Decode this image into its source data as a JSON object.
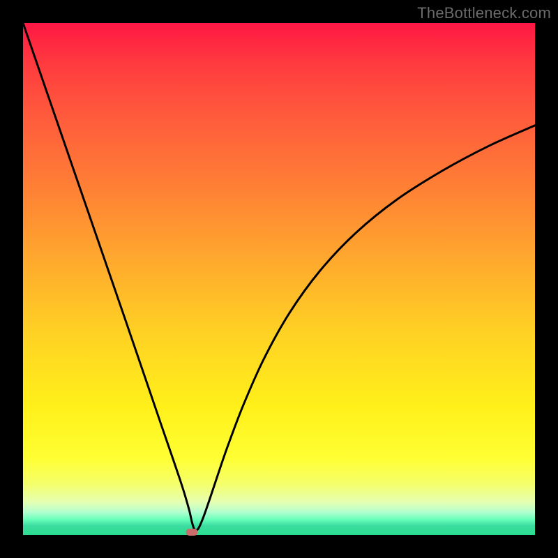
{
  "watermark": "TheBottleneck.com",
  "colors": {
    "curve": "#000000",
    "marker": "#cc6b6b",
    "frame": "#000000"
  },
  "chart_data": {
    "type": "line",
    "title": "",
    "xlabel": "",
    "ylabel": "",
    "xlim": [
      0,
      100
    ],
    "ylim": [
      0,
      100
    ],
    "grid": false,
    "legend": null,
    "series": [
      {
        "name": "bottleneck-curve",
        "x": [
          0,
          5,
          10,
          15,
          20,
          24,
          27,
          29,
          30.5,
          31.5,
          32.5,
          33,
          33.5,
          34.2,
          35.2,
          36.5,
          38,
          40,
          43,
          47,
          52,
          58,
          65,
          73,
          82,
          91,
          100
        ],
        "y": [
          100,
          85.5,
          71,
          56.5,
          42,
          30.3,
          21.5,
          15.7,
          11.3,
          8.2,
          4.7,
          2.5,
          1.1,
          1.2,
          3.4,
          7.1,
          11.6,
          17.4,
          25.3,
          34.3,
          43.3,
          51.6,
          59.0,
          65.5,
          71.2,
          76.0,
          80.0
        ]
      }
    ],
    "marker": {
      "x": 33.0,
      "y": 0.6
    }
  }
}
